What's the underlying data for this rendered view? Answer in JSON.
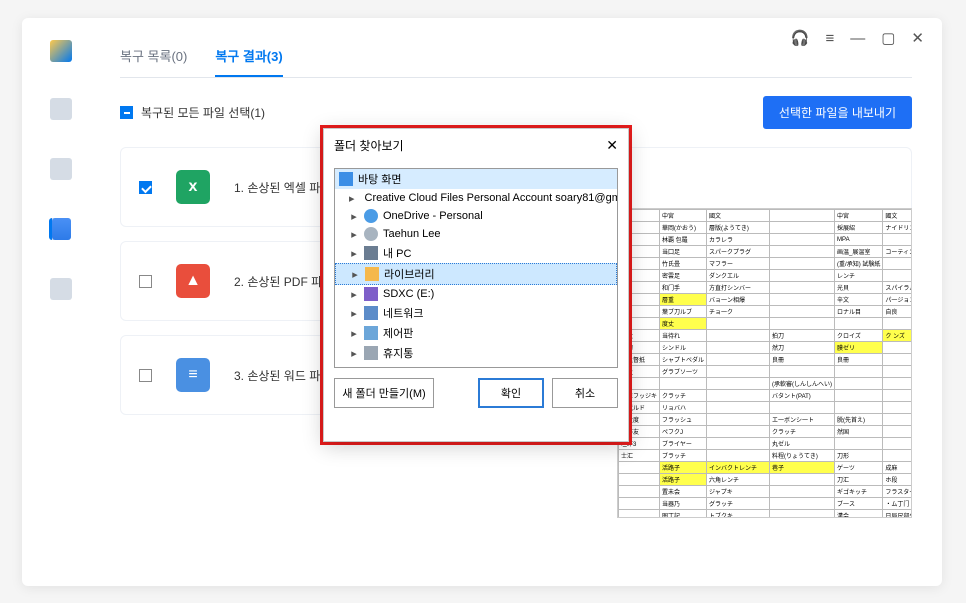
{
  "titlebar": {
    "headset": "🎧",
    "menu": "≡",
    "min": "—",
    "max": "▢",
    "close": "✕"
  },
  "tabs": {
    "list": "복구 목록(0)",
    "result": "복구 결과(3)"
  },
  "selectall": "복구된 모든 파일 선택(1)",
  "exportbtn": "선택한 파일을 내보내기",
  "files": {
    "f1": "1. 손상된 엑셀 파…",
    "f2": "2. 손상된 PDF 파…",
    "f3": "3. 손상된 워드 파…"
  },
  "dialog": {
    "title": "폴더 찾아보기",
    "newfolder": "새 폴더 만들기(M)",
    "ok": "확인",
    "cancel": "취소",
    "tree": {
      "root": "바탕 화면",
      "n1": "Creative Cloud Files Personal Account soary81@gm",
      "n2": "OneDrive - Personal",
      "n3": "Taehun Lee",
      "n4": "내 PC",
      "n5": "라이브러리",
      "n6": "SDXC (E:)",
      "n7": "네트워크",
      "n8": "제어판",
      "n9": "휴지통"
    }
  }
}
